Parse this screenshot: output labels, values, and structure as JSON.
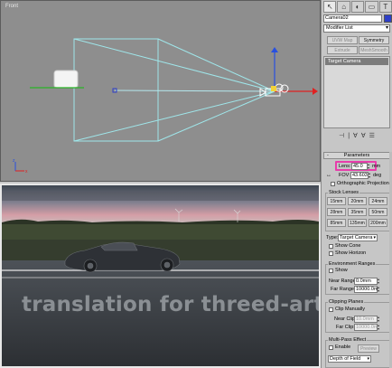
{
  "viewport_top": {
    "label": "Front"
  },
  "viewport_bottom": {
    "label": ""
  },
  "watermark": "translation for threed-art-com",
  "panel": {
    "tabs": [
      "↖",
      "⌂",
      "◐",
      "▭",
      "T"
    ],
    "object_name": "Camera02",
    "modifier_list": "Modifier List",
    "buttons": {
      "uvw_map": "UVW Map",
      "symmetry": "Symmetry",
      "extrude": "Extrude",
      "meshsmooth": "MeshSmooth"
    },
    "stack_item": "Target Camera",
    "stack_tools": [
      "⊣",
      "|",
      "∀",
      "∀",
      "☰"
    ],
    "parameters": {
      "title": "Parameters",
      "lens_label": "Lens:",
      "lens_value": "45.0",
      "lens_unit": "mm",
      "fov_label": "FOV:",
      "fov_value": "43.603",
      "fov_unit": "deg",
      "ortho_label": "Orthographic Projection",
      "stock_lenses_title": "Stock Lenses",
      "stock_lenses": [
        "15mm",
        "20mm",
        "24mm",
        "28mm",
        "35mm",
        "50mm",
        "85mm",
        "135mm",
        "200mm"
      ],
      "type_label": "Type:",
      "type_value": "Target Camera",
      "show_cone": "Show Cone",
      "show_horizon": "Show Horizon",
      "env_ranges_title": "Environment Ranges",
      "env_show": "Show",
      "near_range_label": "Near Range:",
      "near_range_value": "0.0mm",
      "far_range_label": "Far Range:",
      "far_range_value": "10000.0m",
      "clipping_title": "Clipping Planes",
      "clip_manually": "Clip Manually",
      "near_clip_label": "Near Clip:",
      "near_clip_value": "10.0mm",
      "far_clip_label": "Far Clip:",
      "far_clip_value": "10000.0m",
      "multipass_title": "Multi-Pass Effect",
      "enable_label": "Enable",
      "preview_label": "Preview",
      "effect_value": "Depth of Field"
    }
  }
}
